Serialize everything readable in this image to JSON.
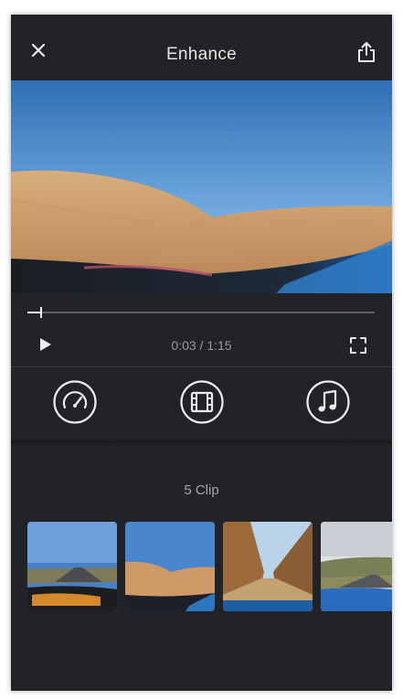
{
  "header": {
    "title": "Enhance",
    "close_icon": "close-icon",
    "share_icon": "share-icon"
  },
  "player": {
    "progress": 0.04,
    "current_time": "0:03",
    "separator": " / ",
    "duration": "1:15",
    "play_icon": "play-icon",
    "fullscreen_icon": "fullscreen-icon"
  },
  "tools": [
    {
      "icon": "speedometer-icon"
    },
    {
      "icon": "film-icon"
    },
    {
      "icon": "music-note-icon"
    }
  ],
  "clips": {
    "label": "5 Clip",
    "count": 5
  },
  "colors": {
    "background": "#222326",
    "accent": "#f2f2f2",
    "muted_text": "#9a9a9d"
  }
}
